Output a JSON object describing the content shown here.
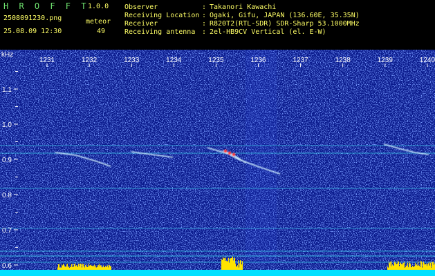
{
  "app": {
    "name": "H R O F F T",
    "version": "1.0.0"
  },
  "file": {
    "name": "2508091230.png",
    "datetime": "25.08.09 12:30"
  },
  "event": {
    "label": "meteor",
    "count": "49"
  },
  "station": {
    "rows": [
      {
        "label": "Observer",
        "sep": ":",
        "value": "Takanori Kawachi"
      },
      {
        "label": "Receiving Location",
        "sep": ":",
        "value": "Ogaki, Gifu, JAPAN (136.60E, 35.35N)"
      },
      {
        "label": "Receiver",
        "sep": ":",
        "value": "R820T2(RTL-SDR) SDR-Sharp 53.1000MHz"
      },
      {
        "label": "Receiving antenna",
        "sep": ":",
        "value": "2el-HB9CV Vertical (el. E-W)"
      }
    ]
  },
  "spectrogram": {
    "y_unit": "kHz",
    "y_ticks": [
      "1.1",
      "1.0",
      "0.9",
      "0.8",
      "0.7",
      "0.6"
    ],
    "x_ticks": [
      "1231",
      "1232",
      "1233",
      "1234",
      "1235",
      "1236",
      "1237",
      "1238",
      "1239",
      "1240"
    ],
    "colors": {
      "background": "#0a1a8c",
      "noise": "#2a49d8",
      "line": "#3ac8e8",
      "echo": "#d0f0ff",
      "hot": "#ff3a3a",
      "bar": "#ffe400",
      "base": "#00e0ff"
    }
  }
}
